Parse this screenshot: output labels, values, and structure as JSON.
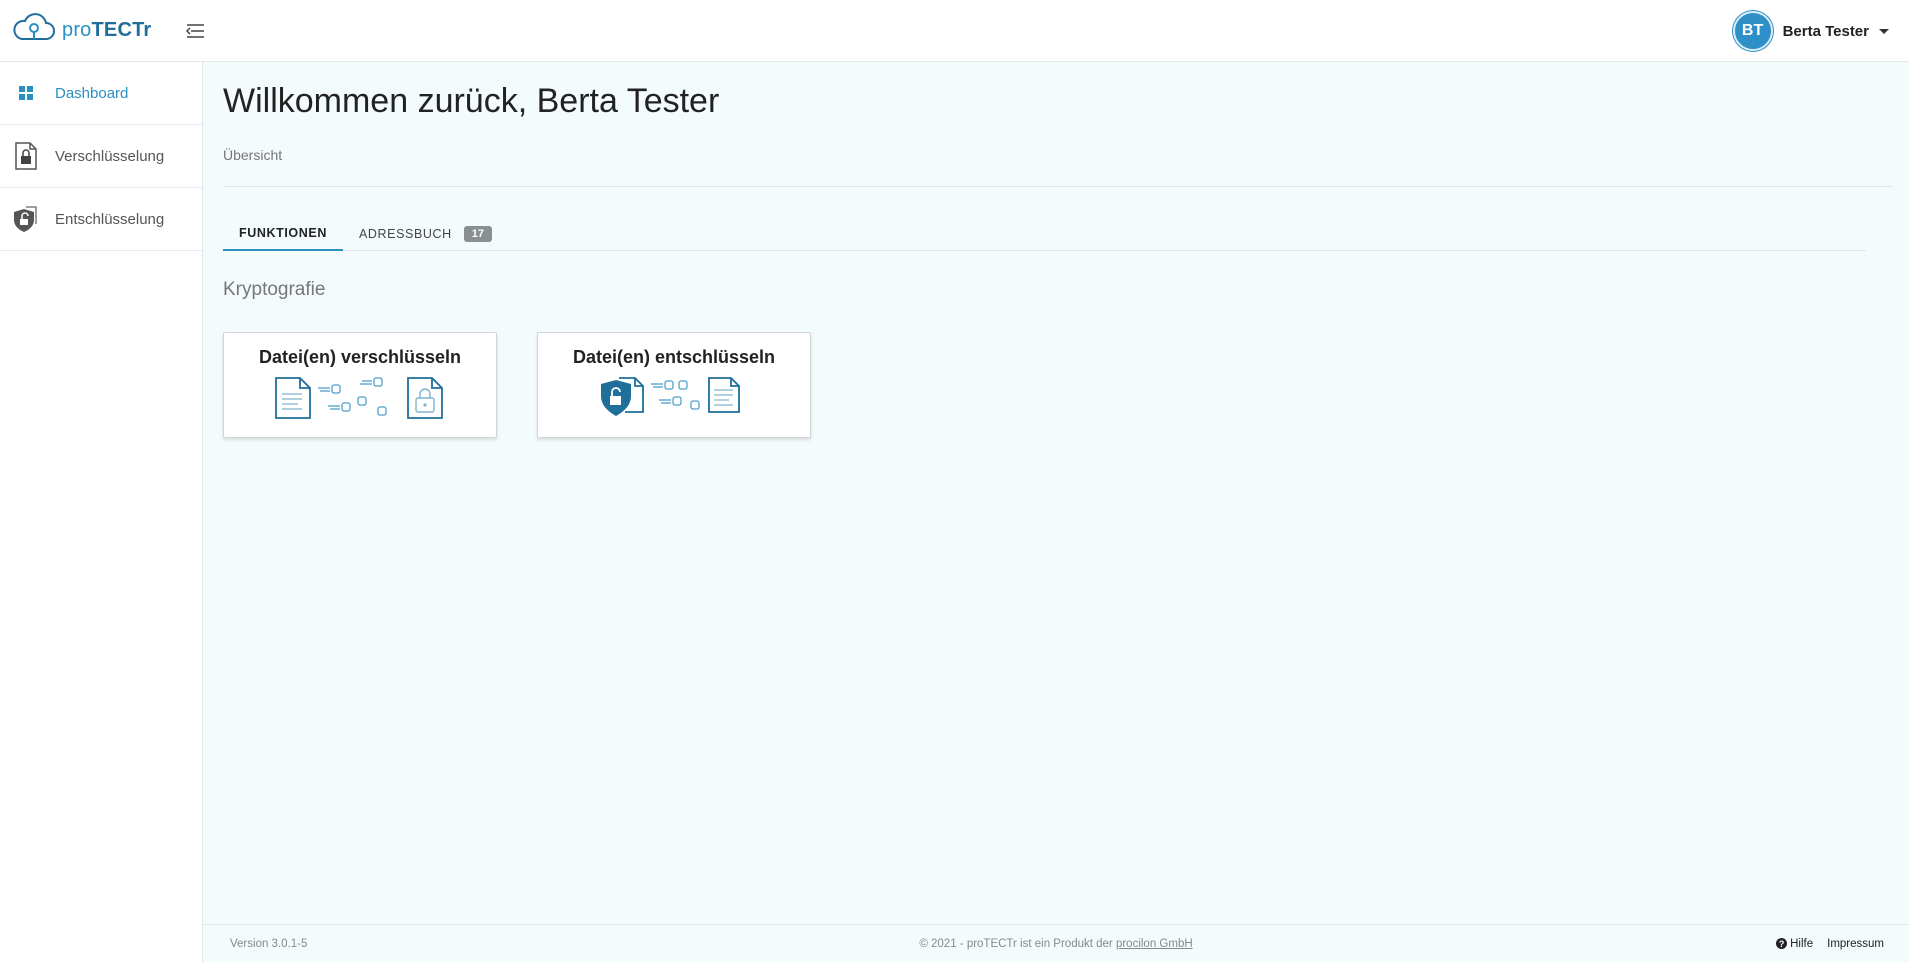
{
  "app": {
    "brand_pre": "pro",
    "brand_strong": "TECTr",
    "icons": {
      "logo": "cloud-lock-icon",
      "toggle": "menu-collapse-icon"
    }
  },
  "user": {
    "initials": "BT",
    "name": "Berta Tester"
  },
  "sidebar": {
    "items": [
      {
        "label": "Dashboard",
        "icon": "dashboard-grid-icon",
        "active": true
      },
      {
        "label": "Verschlüsselung",
        "icon": "file-lock-icon",
        "active": false
      },
      {
        "label": "Entschlüsselung",
        "icon": "shield-unlock-icon",
        "active": false
      }
    ]
  },
  "main": {
    "title": "Willkommen zurück, Berta Tester",
    "breadcrumb": "Übersicht",
    "tabs": [
      {
        "label": "FUNKTIONEN",
        "active": true
      },
      {
        "label": "ADRESSBUCH",
        "badge": "17",
        "active": false
      }
    ],
    "section_title": "Kryptografie",
    "cards": [
      {
        "title": "Datei(en) verschlüsseln",
        "icon": "encrypt-file-illustration"
      },
      {
        "title": "Datei(en) entschlüsseln",
        "icon": "decrypt-file-illustration"
      }
    ]
  },
  "footer": {
    "version": "Version 3.0.1-5",
    "copyright_text": "© 2021 - proTECTr ist ein Produkt der ",
    "company_link": "procilon GmbH",
    "help": "Hilfe",
    "help_icon": "question-circle-icon",
    "impressum": "Impressum"
  },
  "colors": {
    "accent": "#2b8fc0",
    "dark_accent": "#1f6f9a",
    "badge": "#8a8f92",
    "background": "#f4fbfd"
  }
}
